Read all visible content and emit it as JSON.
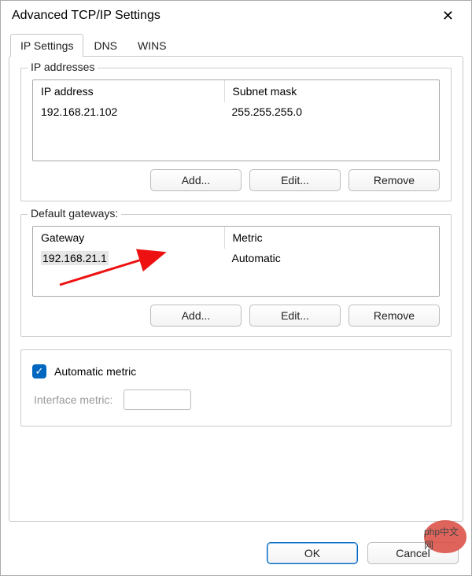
{
  "window": {
    "title": "Advanced TCP/IP Settings"
  },
  "tabs": [
    {
      "label": "IP Settings",
      "active": true
    },
    {
      "label": "DNS",
      "active": false
    },
    {
      "label": "WINS",
      "active": false
    }
  ],
  "ip_addresses": {
    "legend": "IP addresses",
    "columns": [
      "IP address",
      "Subnet mask"
    ],
    "rows": [
      {
        "ip": "192.168.21.102",
        "mask": "255.255.255.0"
      }
    ],
    "buttons": {
      "add": "Add...",
      "edit": "Edit...",
      "remove": "Remove"
    }
  },
  "gateways": {
    "legend": "Default gateways:",
    "columns": [
      "Gateway",
      "Metric"
    ],
    "rows": [
      {
        "gw": "192.168.21.1",
        "metric": "Automatic",
        "selected": true
      }
    ],
    "buttons": {
      "add": "Add...",
      "edit": "Edit...",
      "remove": "Remove"
    }
  },
  "metric": {
    "auto_label": "Automatic metric",
    "auto_checked": true,
    "interface_label": "Interface metric:",
    "interface_value": ""
  },
  "footer": {
    "ok": "OK",
    "cancel": "Cancel"
  },
  "watermark": {
    "text": "php中文网"
  }
}
